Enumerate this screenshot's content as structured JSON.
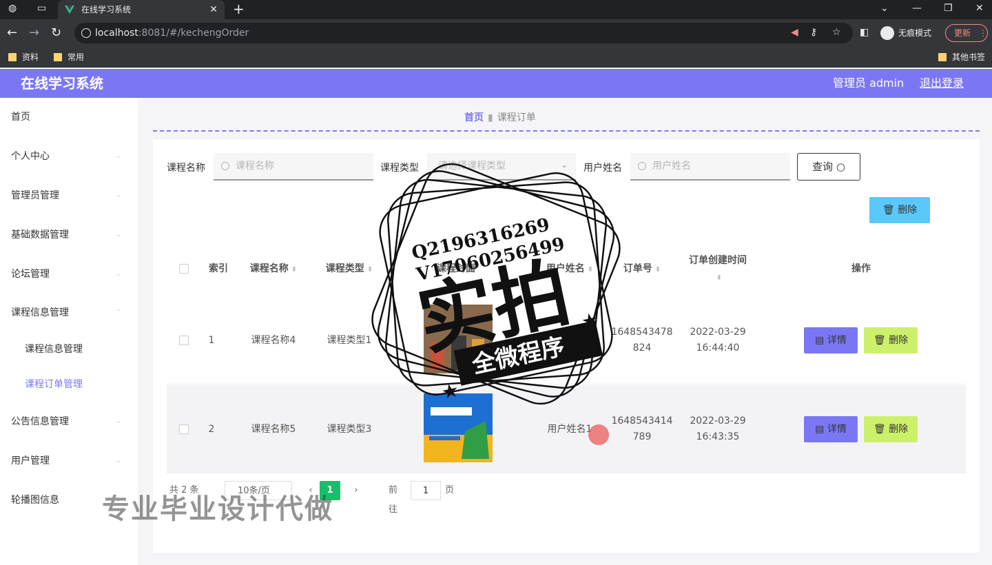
{
  "browser": {
    "tab_title": "在线学习系统",
    "url_host": "localhost",
    "url_path": ":8081/#/kechengOrder",
    "incognito_label": "无痕模式",
    "update_label": "更新",
    "bookmarks": [
      "资料",
      "常用"
    ],
    "other_bookmarks": "其他书签"
  },
  "header": {
    "title": "在线学习系统",
    "admin_label": "管理员 admin",
    "logout_label": "退出登录"
  },
  "sidebar": {
    "items": [
      {
        "label": "首页"
      },
      {
        "label": "个人中心"
      },
      {
        "label": "管理员管理"
      },
      {
        "label": "基础数据管理"
      },
      {
        "label": "论坛管理"
      },
      {
        "label": "课程信息管理"
      },
      {
        "label": "课程信息管理"
      },
      {
        "label": "课程订单管理"
      },
      {
        "label": "公告信息管理"
      },
      {
        "label": "用户管理"
      },
      {
        "label": "轮播图信息"
      }
    ]
  },
  "breadcrumb": {
    "home": "首页",
    "current": "课程订单"
  },
  "search": {
    "course_name_label": "课程名称",
    "course_name_placeholder": "课程名称",
    "course_type_label": "课程类型",
    "course_type_placeholder": "请选择课程类型",
    "user_name_label": "用户姓名",
    "user_name_placeholder": "用户姓名",
    "query_label": "查询",
    "bulk_delete_label": "删除"
  },
  "table": {
    "columns": [
      "索引",
      "课程名称",
      "课程类型",
      "课程封面",
      "用户姓名",
      "订单号",
      "订单创建时间",
      "操作"
    ],
    "rows": [
      {
        "index": "1",
        "course_name": "课程名称4",
        "course_type": "课程类型1",
        "user_name": "用户姓名1",
        "order_no_1": "1648543478",
        "order_no_2": "824",
        "date": "2022-03-29",
        "time": "16:44:40"
      },
      {
        "index": "2",
        "course_name": "课程名称5",
        "course_type": "课程类型3",
        "user_name": "用户姓名1",
        "order_no_1": "1648543414",
        "order_no_2": "789",
        "date": "2022-03-29",
        "time": "16:43:35"
      }
    ],
    "detail_label": "详情",
    "delete_label": "删除"
  },
  "pagination": {
    "total": "共 2 条",
    "page_size": "10条/页",
    "prev": "‹",
    "current_page": "1",
    "next": "›",
    "goto_label": "前往",
    "goto_value": "1",
    "page_unit": "页"
  },
  "watermark": {
    "qq": "Q2196316269",
    "wechat": "V17060256499",
    "big": "实拍",
    "banner": "全微程序",
    "bottom": "专业毕业设计代做"
  },
  "colors": {
    "primary": "#7b77f4",
    "detail": "#7b77f4",
    "delete": "#cdf06b",
    "bulk_delete": "#5ac8fa",
    "page_active": "#19be6b"
  }
}
